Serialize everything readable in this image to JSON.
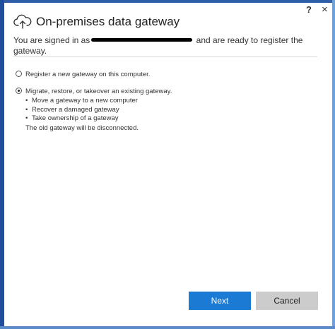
{
  "window": {
    "help_glyph": "?",
    "close_glyph": "×"
  },
  "header": {
    "title": "On-premises data gateway",
    "subtitle_before": "You are signed in as",
    "subtitle_after": "and are ready to register the gateway."
  },
  "options": [
    {
      "label": "Register a new gateway on this computer.",
      "selected": false
    },
    {
      "label": "Migrate, restore, or takeover an existing gateway.",
      "selected": true
    }
  ],
  "migrate_details": {
    "bullets": [
      "Move a gateway to a new computer",
      "Recover a damaged gateway",
      "Take ownership of a gateway"
    ],
    "note": "The old gateway will be disconnected."
  },
  "footer": {
    "next_label": "Next",
    "cancel_label": "Cancel"
  },
  "colors": {
    "primary_button": "#1a7ad4",
    "secondary_button": "#cccccc",
    "frame": "#2f5da8"
  },
  "icons": {
    "app": "cloud-upload-icon",
    "help": "help-icon",
    "close": "close-icon"
  }
}
